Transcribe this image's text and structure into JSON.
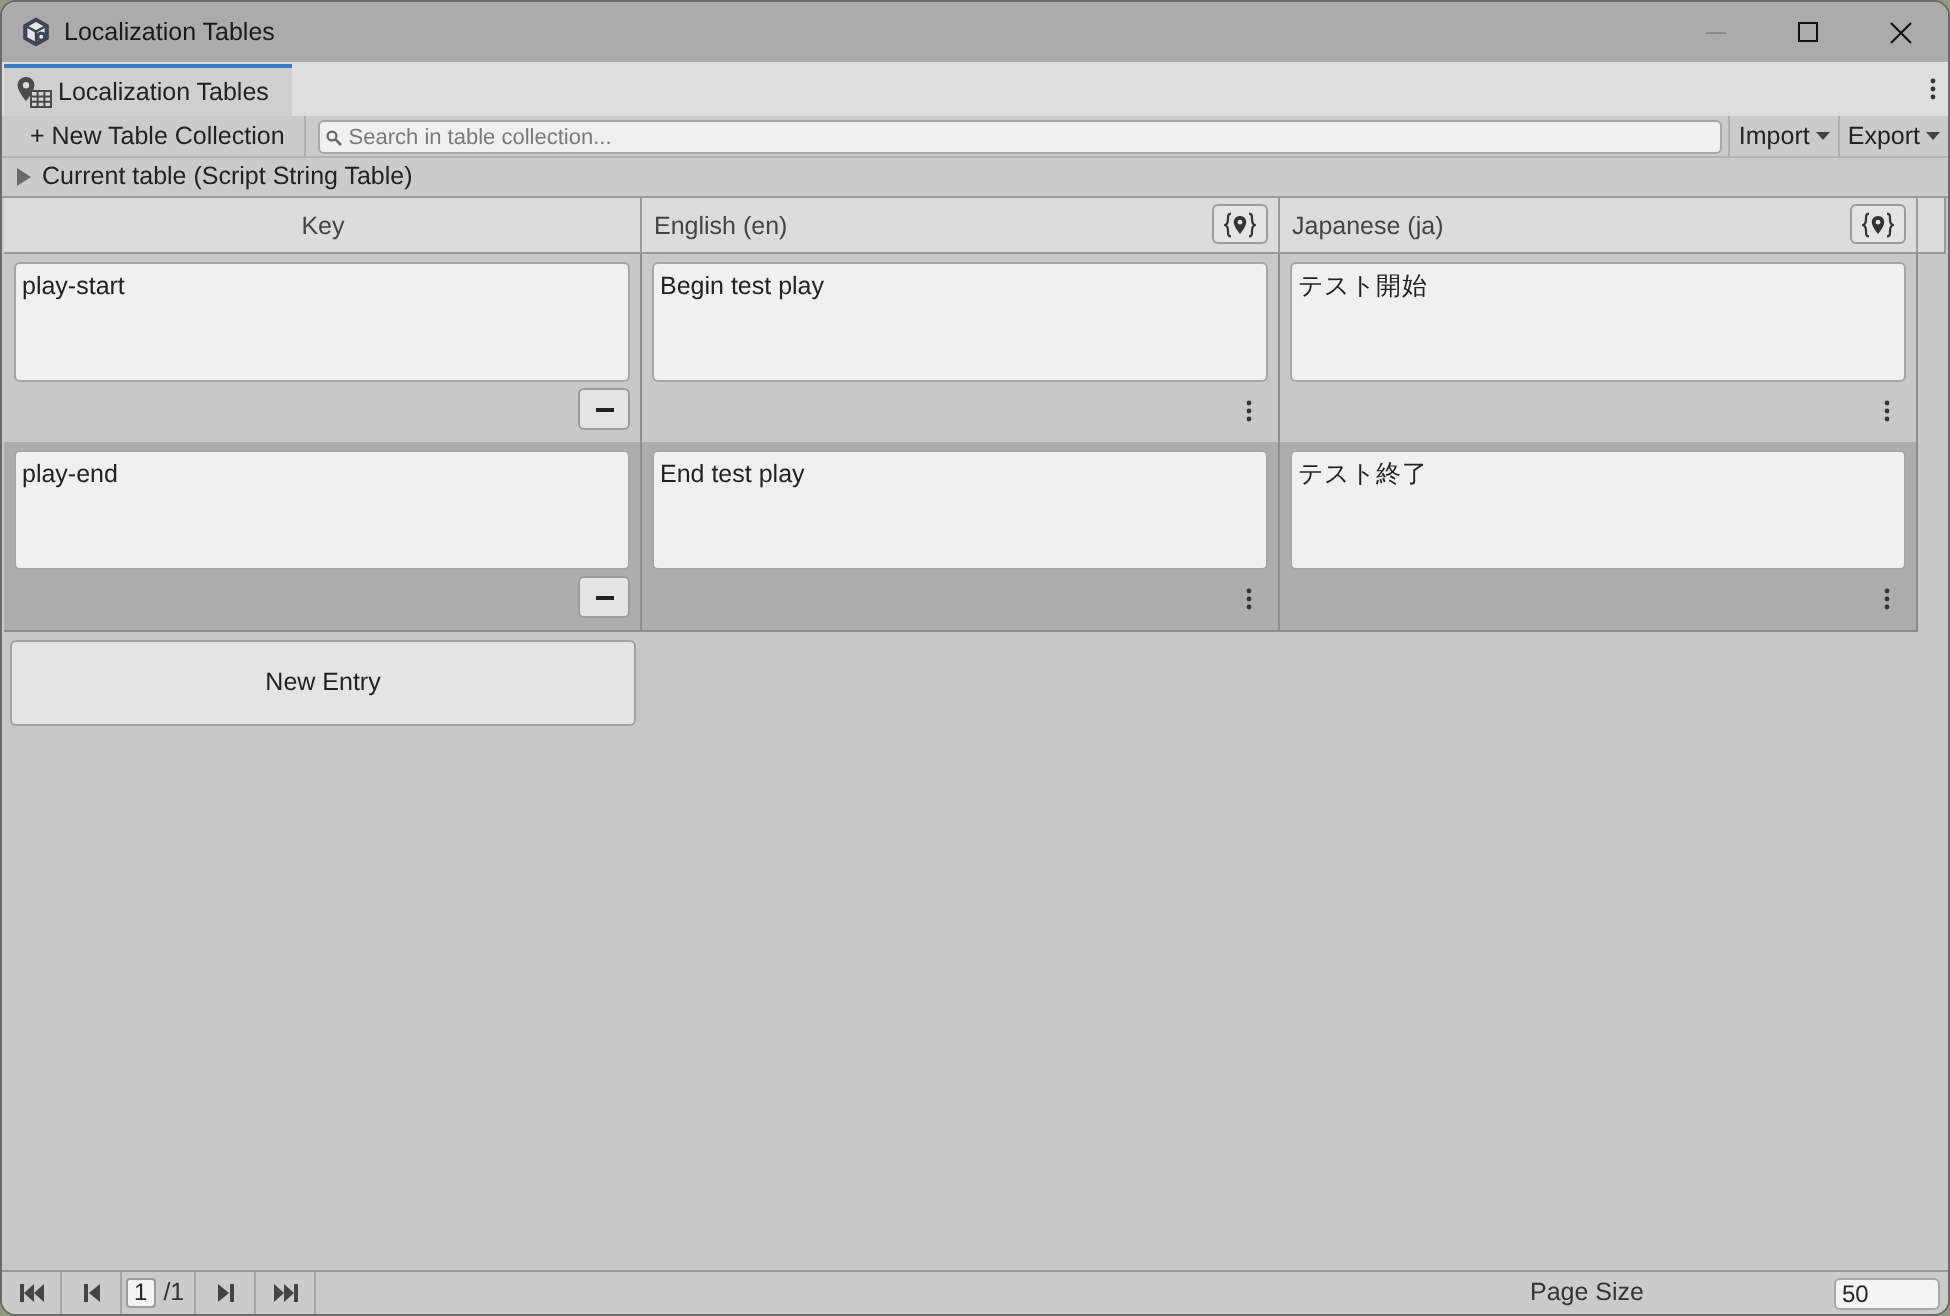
{
  "window": {
    "title": "Localization Tables"
  },
  "tabs": [
    {
      "label": "Localization Tables",
      "selected": true
    }
  ],
  "toolbar": {
    "new_button": "+ New Table Collection",
    "search": {
      "placeholder": "Search in table collection..."
    },
    "menus": [
      "Import",
      "Export"
    ]
  },
  "foldout": {
    "label": "Current table (Script String Table)",
    "expanded": false
  },
  "table": {
    "columns": [
      {
        "label": "Key",
        "kind": "key"
      },
      {
        "label": "English (en)",
        "kind": "locale"
      },
      {
        "label": "Japanese (ja)",
        "kind": "locale"
      }
    ],
    "rows": [
      {
        "cells": [
          "play-start",
          "Begin test play",
          "テスト開始"
        ]
      },
      {
        "cells": [
          "play-end",
          "End test play",
          "テスト終了"
        ]
      }
    ]
  },
  "new_entry_button": "New Entry",
  "pager": {
    "page": "1",
    "total": "/1",
    "page_size_label": "Page Size",
    "page_size": "50"
  }
}
